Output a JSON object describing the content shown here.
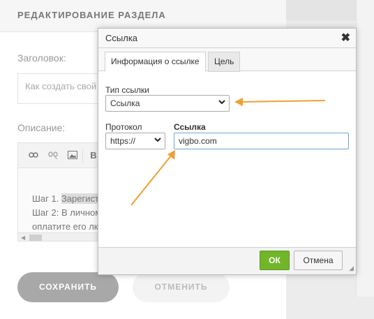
{
  "panel": {
    "title": "РЕДАКТИРОВАНИЕ РАЗДЕЛА",
    "heading_label": "Заголовок:",
    "heading_placeholder": "Как создать свой",
    "description_label": "Описание:",
    "editor_lines": [
      "Шаг 1. Зарегист",
      "Шаг 2: В личном",
      "оплатите его лк"
    ],
    "editor_highlight": "Зарегист",
    "save_label": "СОХРАНИТЬ",
    "cancel_label": "ОТМЕНИТЬ"
  },
  "dialog": {
    "title": "Ссылка",
    "close_glyph": "✖",
    "tabs": [
      "Информация о ссылке",
      "Цель"
    ],
    "link_type_label": "Тип ссылки",
    "link_type_value": "Ссылка",
    "protocol_label": "Протокол",
    "protocol_value": "https://",
    "url_label": "Ссылка",
    "url_value": "vigbo.com",
    "ok_label": "ОК",
    "cancel_label": "Отмена"
  },
  "colors": {
    "accent_arrow": "#f0a030",
    "ok_green": "#73b52a",
    "save_grey": "#a8a8a8"
  }
}
